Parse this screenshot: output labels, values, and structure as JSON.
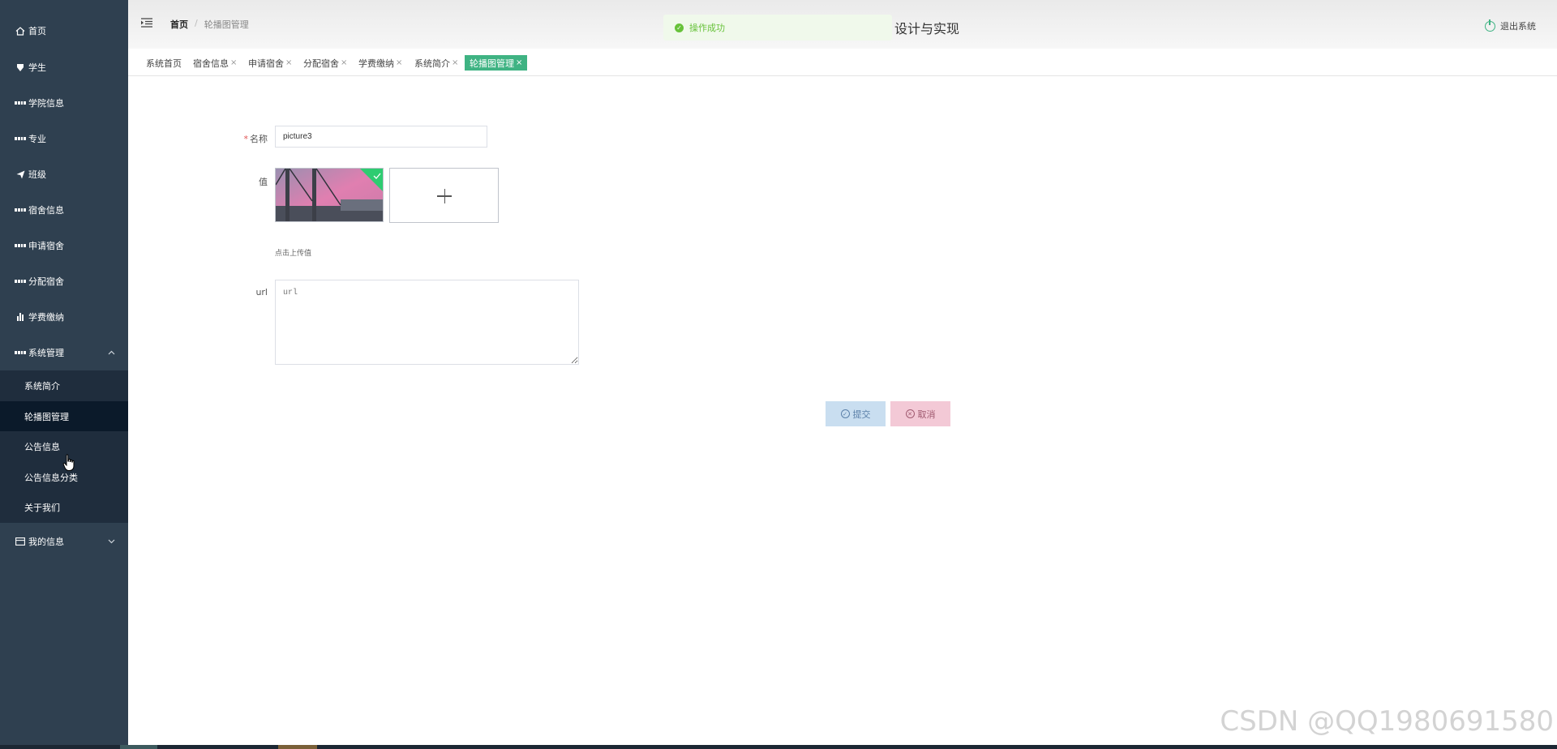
{
  "sidebar": {
    "items": [
      {
        "label": "首页",
        "icon": "home-icon"
      },
      {
        "label": "学生",
        "icon": "shield-icon"
      },
      {
        "label": "学院信息",
        "icon": "grid-icon"
      },
      {
        "label": "专业",
        "icon": "grid-icon"
      },
      {
        "label": "班级",
        "icon": "send-icon"
      },
      {
        "label": "宿舍信息",
        "icon": "grid-icon"
      },
      {
        "label": "申请宿舍",
        "icon": "grid-icon"
      },
      {
        "label": "分配宿舍",
        "icon": "grid-icon"
      },
      {
        "label": "学费缴纳",
        "icon": "bar-chart-icon"
      },
      {
        "label": "系统管理",
        "icon": "grid-icon"
      }
    ],
    "submenu": [
      "系统简介",
      "轮播图管理",
      "公告信息",
      "公告信息分类",
      "关于我们"
    ],
    "my_info": "我的信息"
  },
  "header": {
    "breadcrumb_home": "首页",
    "breadcrumb_sep": "/",
    "breadcrumb_current": "轮播图管理",
    "toast": "操作成功",
    "title": "设计与实现",
    "logout": "退出系统"
  },
  "tabs": [
    {
      "label": "系统首页",
      "closable": false
    },
    {
      "label": "宿舍信息",
      "closable": true
    },
    {
      "label": "申请宿舍",
      "closable": true
    },
    {
      "label": "分配宿舍",
      "closable": true
    },
    {
      "label": "学费缴纳",
      "closable": true
    },
    {
      "label": "系统简介",
      "closable": true
    },
    {
      "label": "轮播图管理",
      "closable": true,
      "active": true
    }
  ],
  "tab_close": "×",
  "form": {
    "name_label": "名称",
    "name_required": "*",
    "name_value": "picture3",
    "value_label": "值",
    "upload_tip": "点击上传值",
    "url_label": "url",
    "url_placeholder": "url",
    "submit": "提交",
    "cancel": "取消"
  },
  "watermark": "CSDN @QQ1980691580",
  "colors": {
    "sidebar_bg": "#2f4050",
    "submenu_bg": "#1f2d3d",
    "accent": "#3fb383",
    "toast_bg": "#f0f9eb",
    "toast_text": "#67c23a"
  }
}
